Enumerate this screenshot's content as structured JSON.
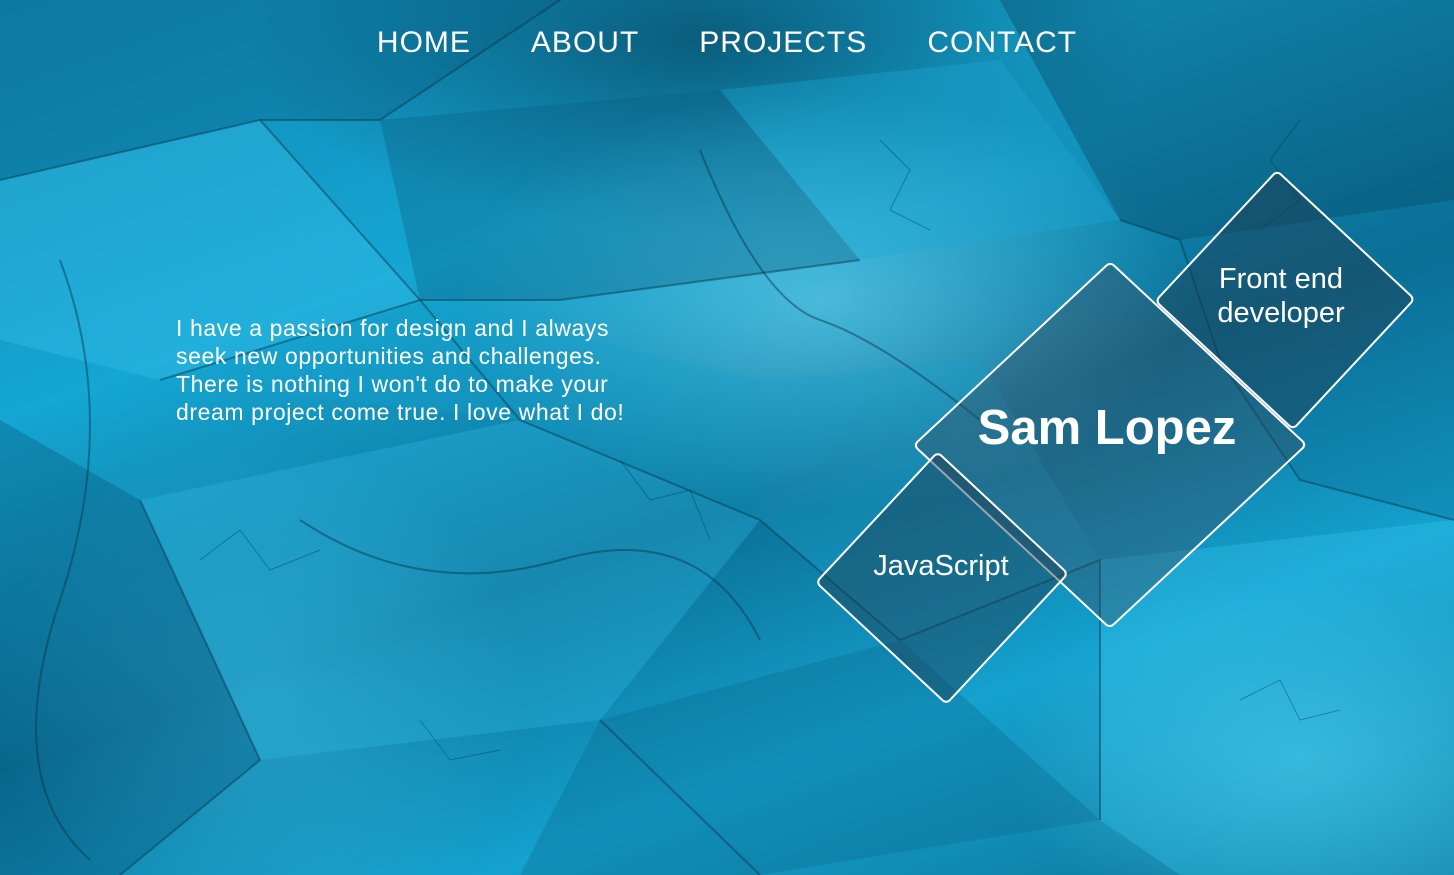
{
  "nav": {
    "items": [
      {
        "label": "HOME"
      },
      {
        "label": "ABOUT"
      },
      {
        "label": "PROJECTS"
      },
      {
        "label": "CONTACT"
      }
    ]
  },
  "intro": {
    "text": "I have a passion for design and I always seek new opportunities and challenges. There is nothing I won't do to make your dream project come true. I love what I do!"
  },
  "hero": {
    "name": "Sam Lopez",
    "role": "Front end developer",
    "skill": "JavaScript"
  },
  "colors": {
    "background": "#0a7fa8",
    "text": "#ffffff",
    "diamond_border": "#ffffff"
  }
}
